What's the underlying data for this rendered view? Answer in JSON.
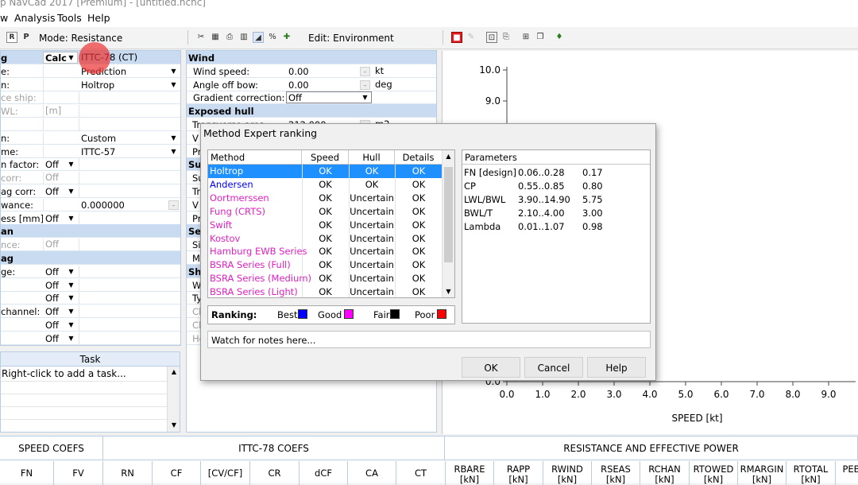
{
  "window": {
    "title": "p NavCad 2017 [Premium] - [untitled.hcnc]",
    "controls": [
      "—",
      "□",
      "✕"
    ]
  },
  "menu": [
    "w",
    "Analysis",
    "Tools",
    "Help"
  ],
  "toolbar": {
    "mode_label": "Mode: Resistance",
    "edit_label": "Edit: Environment",
    "left_icons": [
      "R",
      "P"
    ]
  },
  "left_panel": {
    "rows": [
      {
        "label": "g",
        "value": "Calc",
        "value2": "ITTC-78 (CT)",
        "section": true
      },
      {
        "label": "e:",
        "value": "Prediction"
      },
      {
        "label": "n:",
        "value": "Holtrop"
      },
      {
        "label": "ce ship:",
        "value": "",
        "grey": true
      },
      {
        "label": "WL:",
        "value": "[m]",
        "grey": true
      },
      {
        "label": "",
        "value": ""
      },
      {
        "label": "n:",
        "value": "Custom"
      },
      {
        "label": "me:",
        "value": "ITTC-57"
      },
      {
        "label": "n factor:",
        "value": "Off"
      },
      {
        "label": "corr:",
        "value": "Off",
        "grey": true
      },
      {
        "label": "ag corr:",
        "value": "Off"
      },
      {
        "label": "wance:",
        "value": "0.000000"
      },
      {
        "label": "ess [mm]:",
        "value": "Off"
      },
      {
        "label": "an",
        "value": "",
        "section": true
      },
      {
        "label": "nce:",
        "value": "Off",
        "grey": true
      },
      {
        "label": "ag",
        "value": "",
        "section": true
      },
      {
        "label": "ge:",
        "value": "Off"
      },
      {
        "label": "",
        "value": "Off"
      },
      {
        "label": "",
        "value": "Off"
      },
      {
        "label": "channel:",
        "value": "Off"
      },
      {
        "label": "",
        "value": "Off"
      },
      {
        "label": "",
        "value": "Off"
      }
    ]
  },
  "mid_panel": {
    "rows": [
      {
        "label": "Wind",
        "section": true
      },
      {
        "label": "Wind speed:",
        "value": "0.00",
        "unit": "kt"
      },
      {
        "label": "Angle off bow:",
        "value": "0.00",
        "unit": "deg"
      },
      {
        "label": "Gradient correction:",
        "value": "Off"
      },
      {
        "label": "Exposed hull",
        "section": true
      },
      {
        "label": "Transverse area:",
        "value": "212.000",
        "unit": "m2"
      },
      {
        "label": "V",
        "value": ""
      },
      {
        "label": "Pr",
        "value": ""
      },
      {
        "label": "Sup",
        "section": true
      },
      {
        "label": "Su",
        "value": ""
      },
      {
        "label": "Tr",
        "value": ""
      },
      {
        "label": "V",
        "value": ""
      },
      {
        "label": "Pr",
        "value": ""
      },
      {
        "label": "Sea",
        "section": true
      },
      {
        "label": "Si",
        "value": ""
      },
      {
        "label": "M",
        "value": ""
      },
      {
        "label": "Sha",
        "section": true
      },
      {
        "label": "W",
        "value": ""
      },
      {
        "label": "Ty",
        "value": ""
      },
      {
        "label": "Cl",
        "value": "",
        "grey": true
      },
      {
        "label": "Cl",
        "value": "",
        "grey": true
      },
      {
        "label": "He",
        "value": "",
        "grey": true
      }
    ]
  },
  "task_panel": {
    "header": "Task",
    "hint": "Right-click to add a task..."
  },
  "chart_data": {
    "type": "line",
    "xlabel": "SPEED [kt]",
    "ylabel": "",
    "xlim": [
      0,
      9
    ],
    "x_ticks": [
      "0.0",
      "1.0",
      "2.0",
      "3.0",
      "4.0",
      "5.0",
      "6.0",
      "7.0",
      "8.0",
      "9.0"
    ],
    "y_ticks_visible": [
      "10.0",
      "9.0",
      "0.0"
    ],
    "series": []
  },
  "bottom_table": {
    "groups": [
      "SPEED COEFS",
      "ITTC-78 COEFS",
      "RESISTANCE AND EFFECTIVE POWER"
    ],
    "columns": [
      {
        "name": "FN"
      },
      {
        "name": "FV"
      },
      {
        "name": "RN"
      },
      {
        "name": "CF"
      },
      {
        "name": "[CV/CF]"
      },
      {
        "name": "CR"
      },
      {
        "name": "dCF"
      },
      {
        "name": "CA"
      },
      {
        "name": "CT"
      },
      {
        "name": "RBARE",
        "unit": "[kN]"
      },
      {
        "name": "RAPP",
        "unit": "[kN]"
      },
      {
        "name": "RWIND",
        "unit": "[kN]"
      },
      {
        "name": "RSEAS",
        "unit": "[kN]"
      },
      {
        "name": "RCHAN",
        "unit": "[kN]"
      },
      {
        "name": "RTOWED",
        "unit": "[kN]"
      },
      {
        "name": "RMARGIN",
        "unit": "[kN]"
      },
      {
        "name": "RTOTAL",
        "unit": "[kN]"
      },
      {
        "name": "PEB",
        "unit": ""
      }
    ]
  },
  "dialog": {
    "title": "Method Expert ranking",
    "table_headers": [
      "Method",
      "Speed",
      "Hull",
      "Details"
    ],
    "methods": [
      {
        "name": "Holtrop",
        "speed": "OK",
        "hull": "OK",
        "details": "OK",
        "color": "#0000ff",
        "selected": true
      },
      {
        "name": "Andersen",
        "speed": "OK",
        "hull": "OK",
        "details": "OK",
        "color": "#0000ff"
      },
      {
        "name": "Oortmerssen",
        "speed": "OK",
        "hull": "Uncertain",
        "details": "OK",
        "color": "#e020c0"
      },
      {
        "name": "Fung (CRTS)",
        "speed": "OK",
        "hull": "Uncertain",
        "details": "OK",
        "color": "#e020c0"
      },
      {
        "name": "Swift",
        "speed": "OK",
        "hull": "Uncertain",
        "details": "OK",
        "color": "#e020c0"
      },
      {
        "name": "Kostov",
        "speed": "OK",
        "hull": "Uncertain",
        "details": "OK",
        "color": "#e020c0"
      },
      {
        "name": "Hamburg EWB Series",
        "speed": "OK",
        "hull": "Uncertain",
        "details": "OK",
        "color": "#e020c0"
      },
      {
        "name": "BSRA Series (Full)",
        "speed": "OK",
        "hull": "Uncertain",
        "details": "OK",
        "color": "#e020c0"
      },
      {
        "name": "BSRA Series (Medium)",
        "speed": "OK",
        "hull": "Uncertain",
        "details": "OK",
        "color": "#e020c0"
      },
      {
        "name": "BSRA Series (Light)",
        "speed": "OK",
        "hull": "Uncertain",
        "details": "OK",
        "color": "#e020c0"
      }
    ],
    "parameters_header": "Parameters",
    "parameters": [
      {
        "name": "FN [design]",
        "range": "0.06..0.28",
        "value": "0.17"
      },
      {
        "name": "CP",
        "range": "0.55..0.85",
        "value": "0.80"
      },
      {
        "name": "LWL/BWL",
        "range": "3.90..14.90",
        "value": "5.75"
      },
      {
        "name": "BWL/T",
        "range": "2.10..4.00",
        "value": "3.00"
      },
      {
        "name": "Lambda",
        "range": "0.01..1.07",
        "value": "0.98"
      }
    ],
    "ranking": {
      "label": "Ranking:",
      "items": [
        {
          "name": "Best",
          "color": "#0000ff"
        },
        {
          "name": "Good",
          "color": "#ff00ff"
        },
        {
          "name": "Fair",
          "color": "#000000"
        },
        {
          "name": "Poor",
          "color": "#ff0000"
        }
      ]
    },
    "notes": "Watch for notes here...",
    "buttons": {
      "ok": "OK",
      "cancel": "Cancel",
      "help": "Help"
    }
  }
}
